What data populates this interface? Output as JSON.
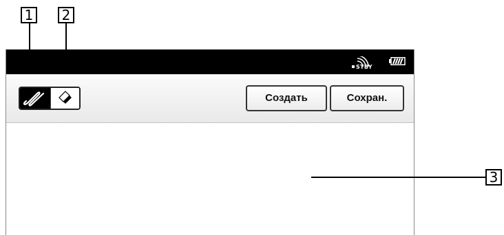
{
  "callouts": {
    "c1": "1",
    "c2": "2",
    "c3": "3"
  },
  "status_bar": {
    "wireless_icon": "wireless-signal-icon",
    "wireless_text": "STBY",
    "battery_icon": "battery-icon"
  },
  "toolbar": {
    "pen_icon": "pen-tool-icon",
    "eraser_icon": "eraser-tool-icon",
    "create_label": "Создать",
    "save_label": "Сохран."
  },
  "colors": {
    "status_bar_bg": "#000000",
    "toolbar_bg": "#f2f2f2",
    "selected_tool_bg": "#000000"
  }
}
